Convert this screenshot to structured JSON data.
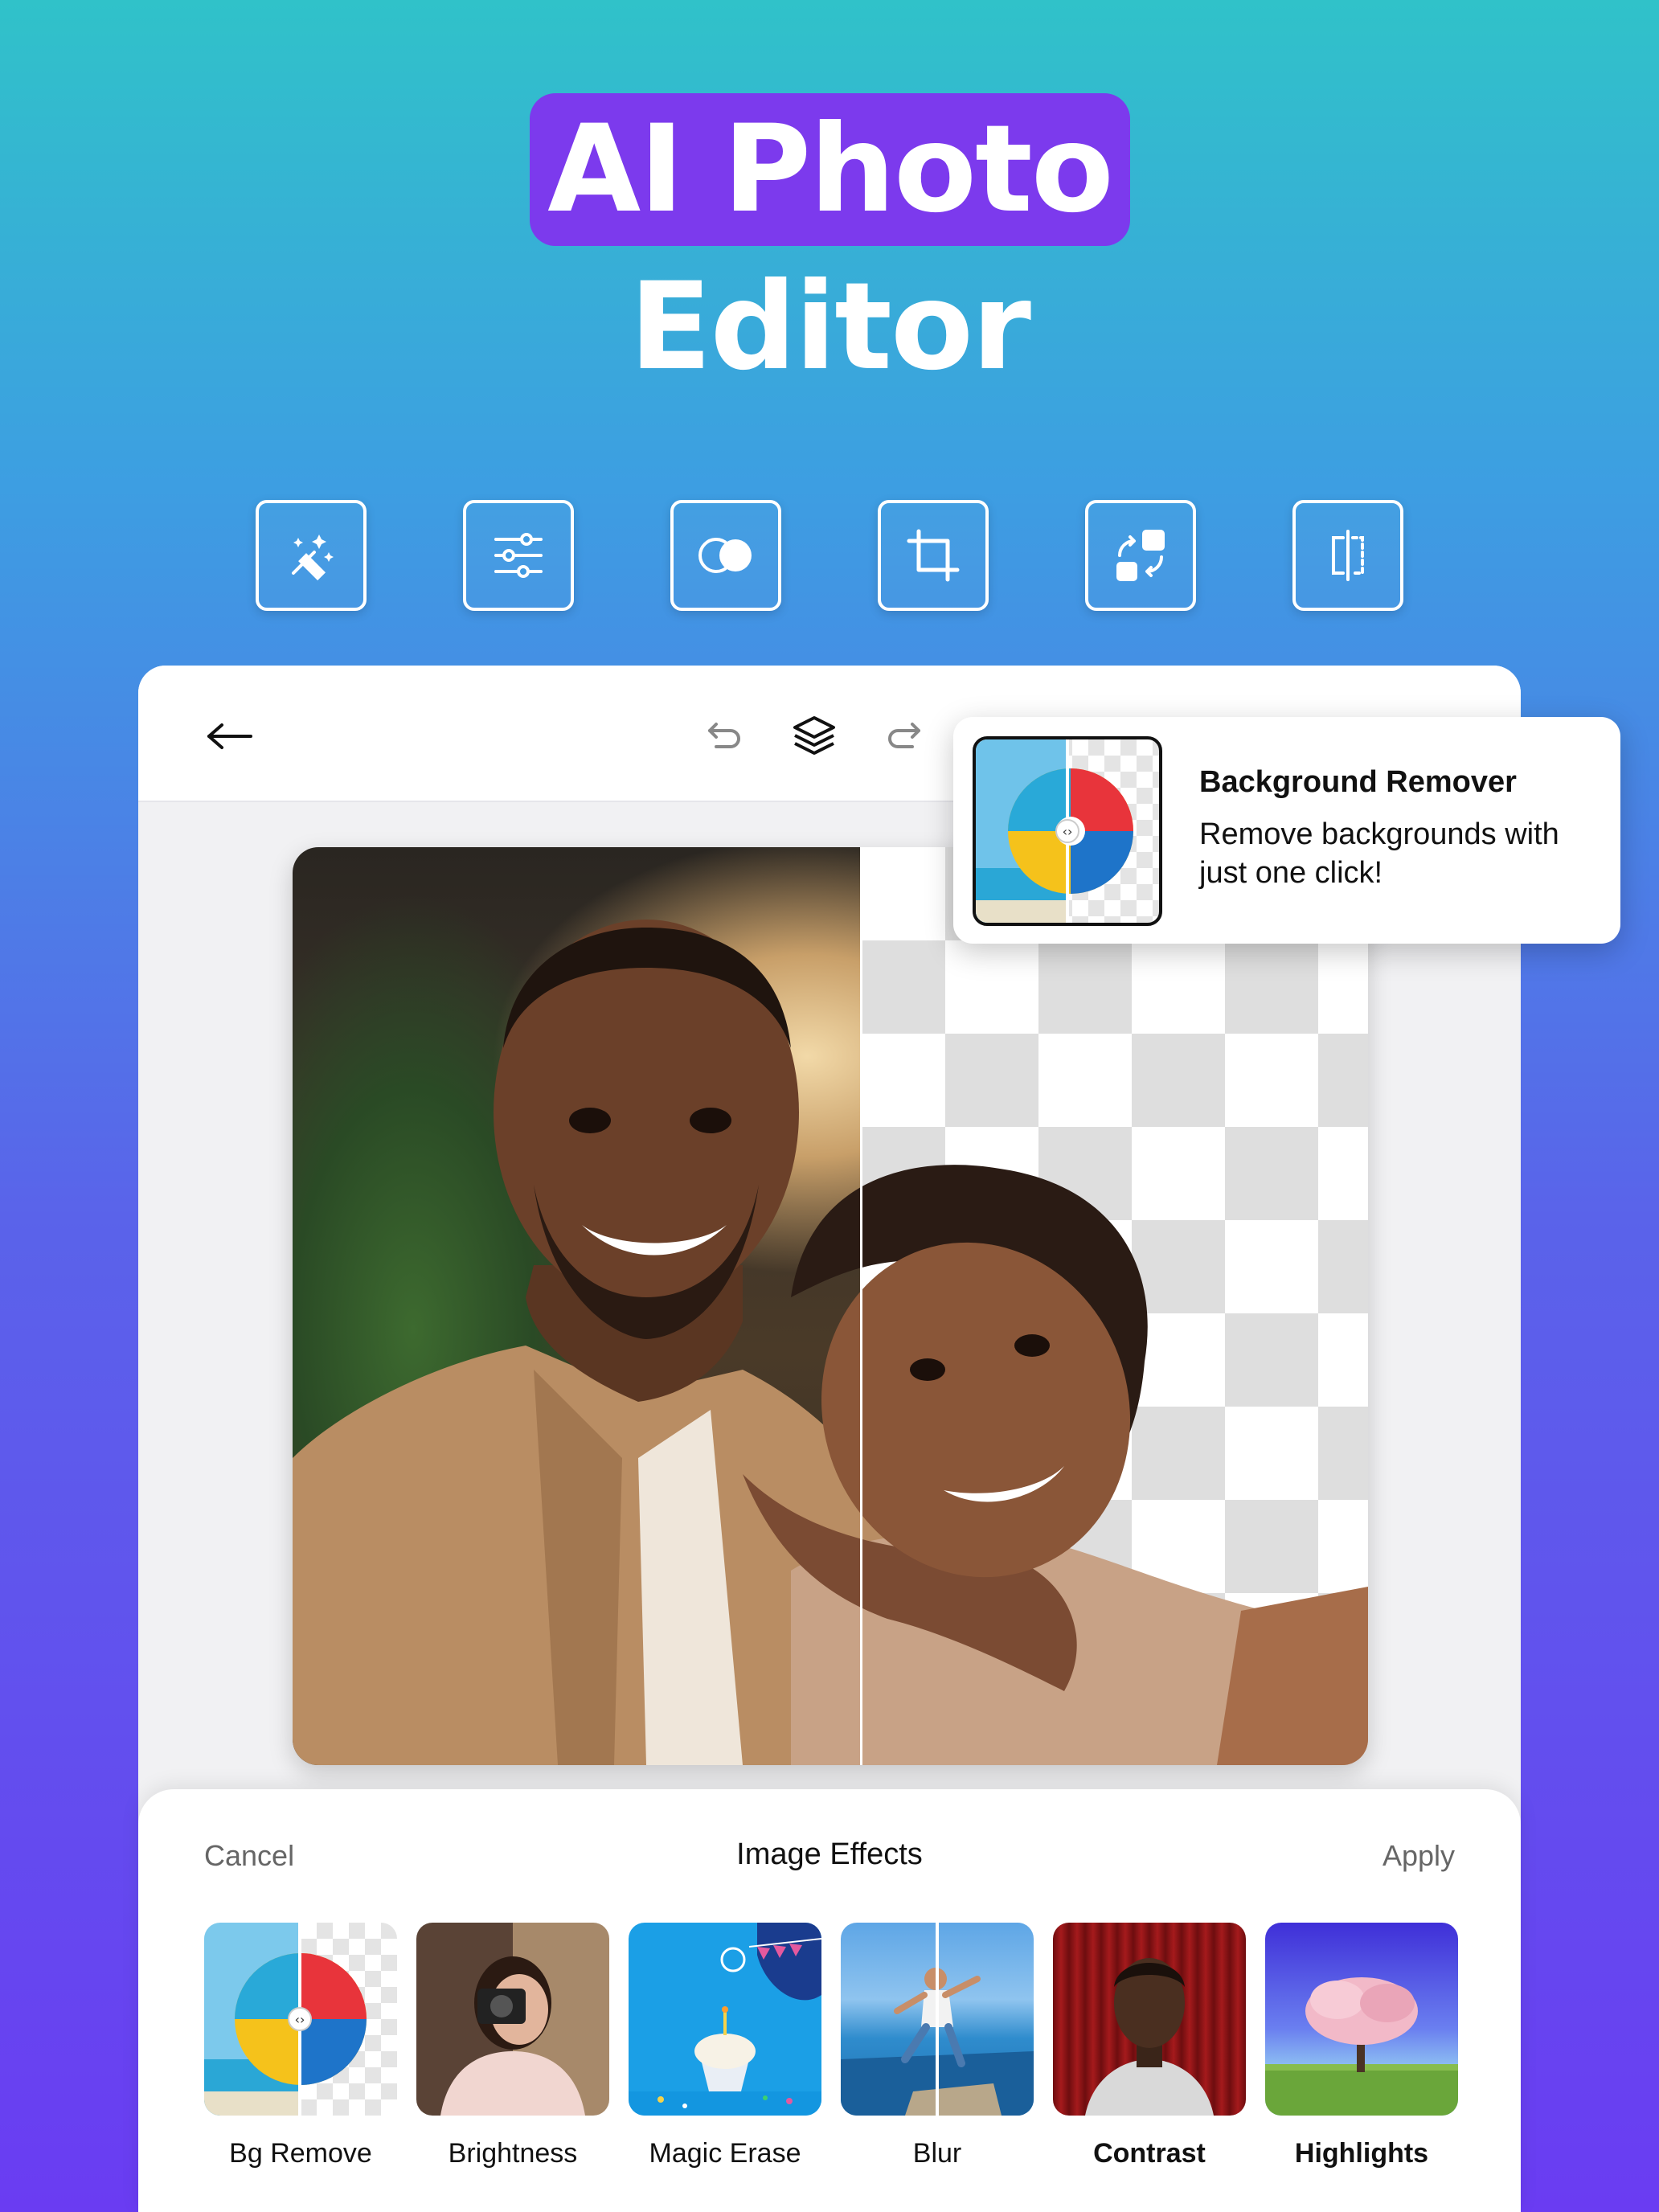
{
  "headline": {
    "line1": "AI Photo",
    "line2": "Editor"
  },
  "tools": [
    {
      "icon": "magic-wand-icon"
    },
    {
      "icon": "sliders-icon"
    },
    {
      "icon": "circles-icon"
    },
    {
      "icon": "crop-icon"
    },
    {
      "icon": "swap-icon"
    },
    {
      "icon": "flip-icon"
    }
  ],
  "topbar": {
    "back": "←"
  },
  "popup": {
    "title": "Background Remover",
    "description": "Remove backgrounds with just one click!"
  },
  "sheet": {
    "cancel": "Cancel",
    "title": "Image Effects",
    "apply": "Apply",
    "effects": [
      {
        "label": "Bg Remove"
      },
      {
        "label": "Brightness"
      },
      {
        "label": "Magic Erase"
      },
      {
        "label": "Blur"
      },
      {
        "label": "Contrast"
      },
      {
        "label": "Highlights"
      }
    ]
  },
  "colors": {
    "accent": "#7c3aed",
    "bg_top": "#30c2c9",
    "bg_bottom": "#6a3cf2"
  }
}
